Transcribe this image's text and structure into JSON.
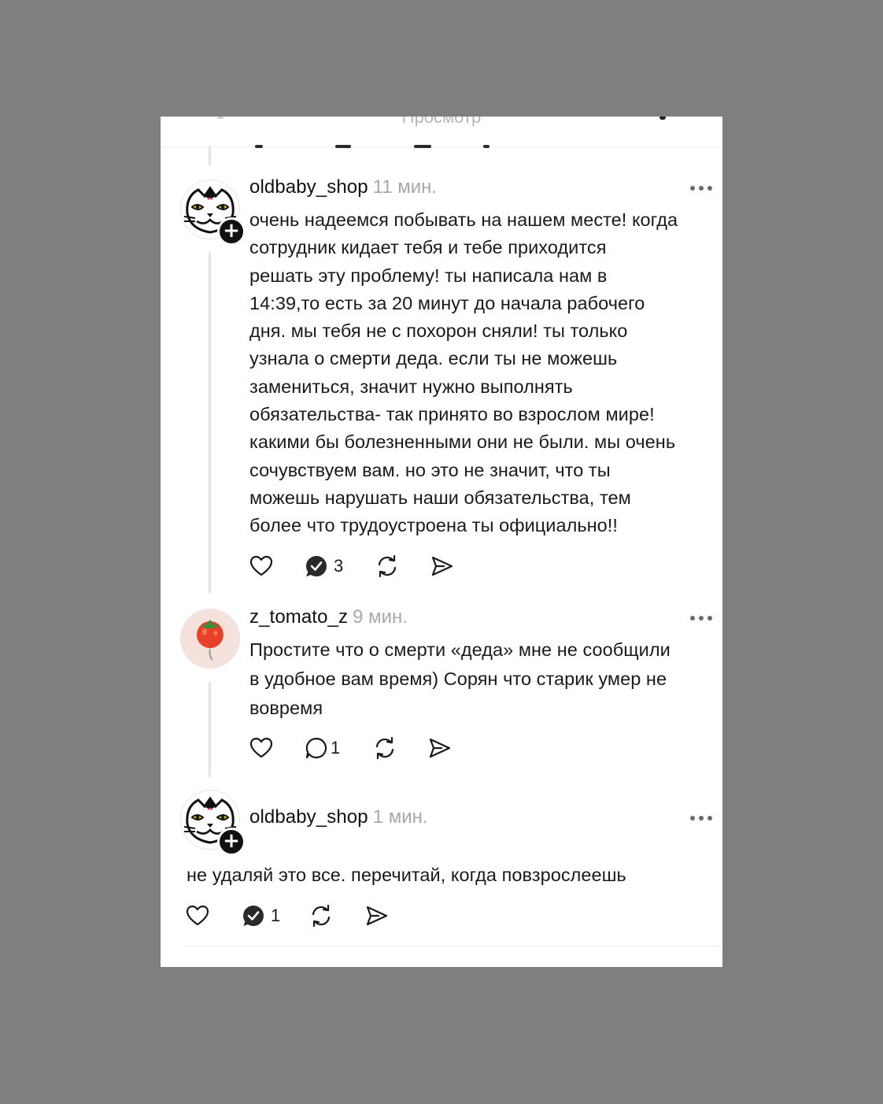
{
  "topbar": {
    "title": "Просмотр"
  },
  "comments": [
    {
      "username": "oldbaby_shop",
      "time": "11 мин.",
      "text": "очень надеемся побывать на нашем месте! когда\nсотрудник кидает тебя и тебе приходится\nрешать эту проблему! ты написала нам в\n14:39,то есть за 20 минут до начала рабочего\nдня. мы тебя не с похорон сняли! ты только\nузнала о смерти деда. если ты не можешь\nзамениться, значит нужно выполнять\nобязательства- так принято во взрослом мире!\nкакими бы болезненными они не были. мы очень\nсочувствуем вам. но это не значит, что ты\nможешь нарушать наши обязательства, тем\nболее что трудоустроена ты официально!!",
      "reply_count": "3",
      "avatar_icon": "cat-face-avatar",
      "reply_icon": "replied-check-icon"
    },
    {
      "username": "z_tomato_z",
      "time": "9 мин.",
      "text": "Простите что о смерти «деда» мне не сообщили\nв удобное вам время) Сорян что старик умер не\nвовремя",
      "reply_count": "1",
      "avatar_icon": "tomato-avatar",
      "reply_icon": "comment-bubble-icon"
    },
    {
      "username": "oldbaby_shop",
      "time": "1 мин.",
      "text": "не удаляй это все. перечитай, когда повзрослеешь",
      "reply_count": "1",
      "avatar_icon": "cat-face-avatar",
      "reply_icon": "replied-check-icon"
    }
  ],
  "colors": {
    "background": "#7f7f7f",
    "card": "#ffffff",
    "text": "#1a1a1a",
    "muted": "#a8a8a8",
    "thread_line": "#e3e3e3"
  }
}
